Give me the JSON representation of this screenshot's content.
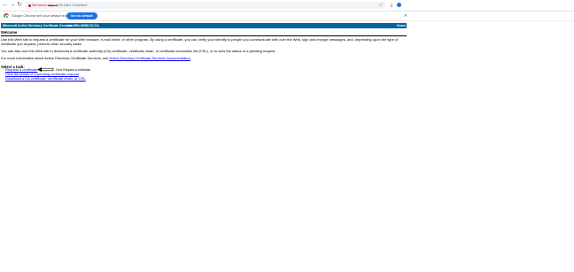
{
  "browser": {
    "security_label": "Not secure",
    "url_scheme": "https://",
    "url_rest": "192.168.1.12/certsrv/",
    "star_icon": "star-icon",
    "colors": {
      "warning": "#c5221f",
      "accent": "#1a73e8"
    }
  },
  "infobar": {
    "message": "Google Chrome isn't your default browser",
    "set_default_label": "Set as default",
    "close_glyph": "✕"
  },
  "header": {
    "product": "Microsoft Active Directory Certificate Services",
    "ca_name": "-- lab-WIN-9DBKC0-CA",
    "home_link": "Home",
    "color": "#006699"
  },
  "content": {
    "welcome_title": "Welcome",
    "para1": "Use this Web site to request a certificate for your Web browser, e-mail client, or other program. By using a certificate, you can verify your identity to people you communicate with over the Web, sign and encrypt messages, and, depending upon the type of certificate you request, perform other security tasks.",
    "para2": "You can also use this Web site to download a certificate authority (CA) certificate, certificate chain, or certificate revocation list (CRL), or to view the status of a pending request.",
    "para3_prefix": "For more information about Active Directory Certificate Services, see ",
    "para3_link": "Active Directory Certificate Services Documentation",
    "para3_suffix": ".",
    "task_label": "Select a task:",
    "tasks": [
      "Request a certificate",
      "View the status of a pending certificate request",
      "Download a CA certificate, certificate chain, or CRL"
    ]
  },
  "annotation": {
    "label": "Click Request a certificate"
  }
}
